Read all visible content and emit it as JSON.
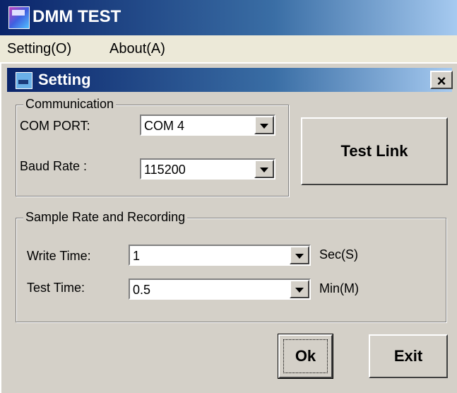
{
  "window": {
    "title": "DMM TEST"
  },
  "menu": [
    {
      "label": "Setting(O)"
    },
    {
      "label": "About(A)"
    }
  ],
  "dialog": {
    "title": "Setting",
    "close_label": "×",
    "communication": {
      "legend": "Communication",
      "com_port_label": "COM PORT:",
      "com_port_value": "COM 4",
      "baud_rate_label": "Baud Rate :",
      "baud_rate_value": "115200"
    },
    "test_link_label": "Test Link",
    "sample": {
      "legend": "Sample Rate and Recording",
      "write_time_label": "Write Time:",
      "write_time_value": "1",
      "write_time_unit": "Sec(S)",
      "test_time_label": "Test Time:",
      "test_time_value": "0.5",
      "test_time_unit": "Min(M)"
    },
    "ok_label": "Ok",
    "exit_label": "Exit"
  }
}
